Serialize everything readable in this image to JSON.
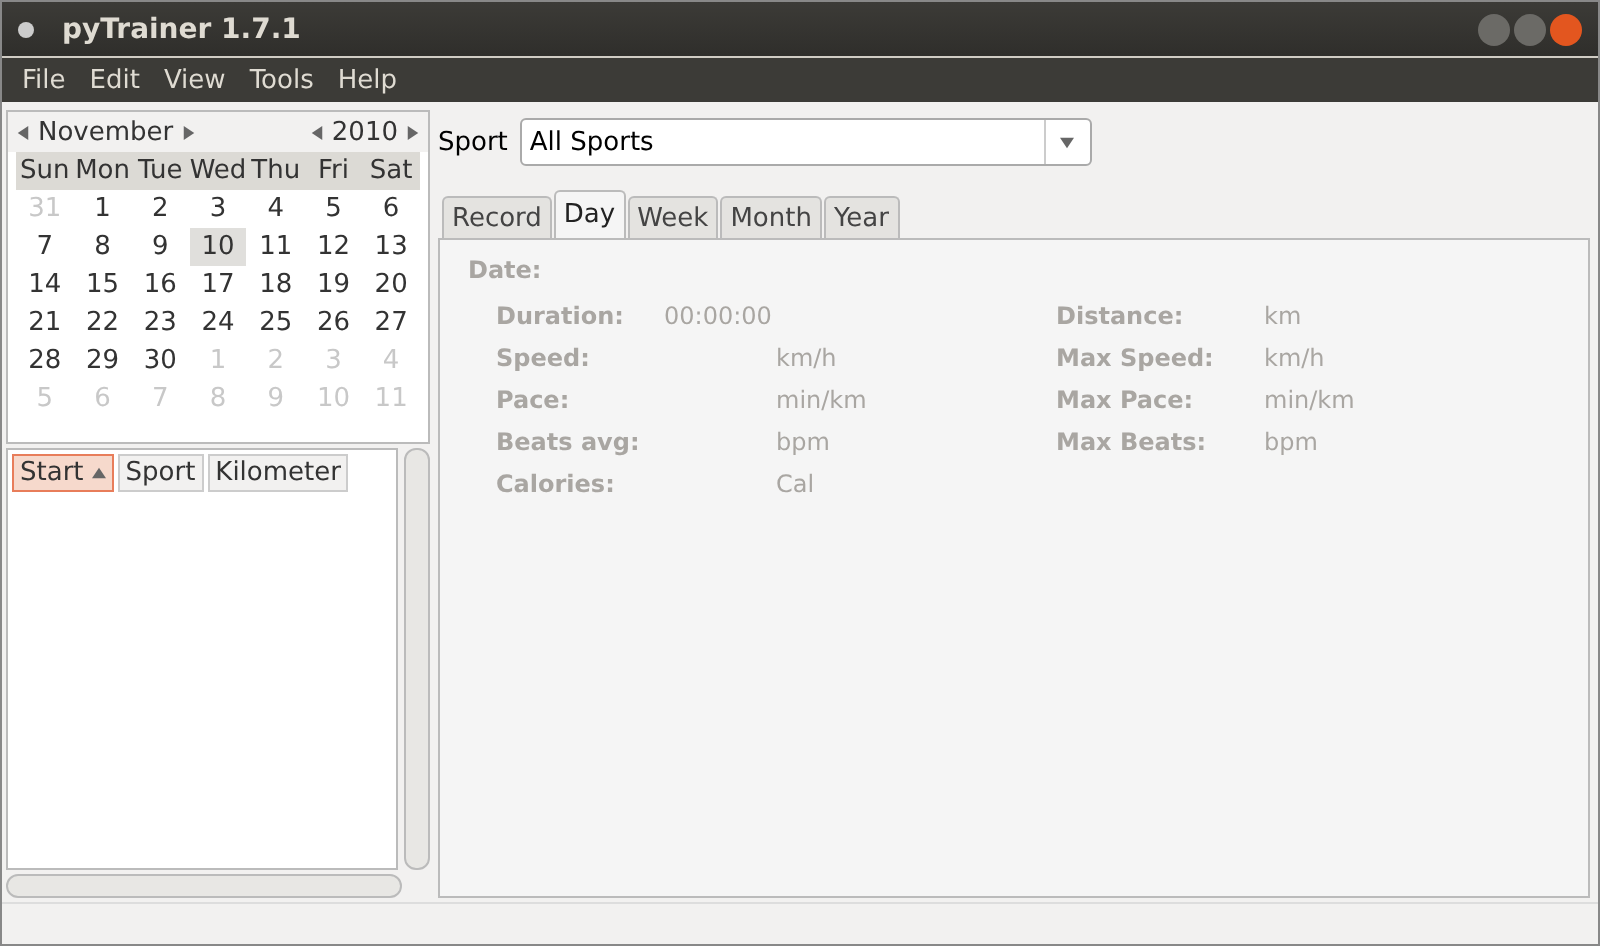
{
  "window": {
    "title": "pyTrainer 1.7.1"
  },
  "menu": [
    "File",
    "Edit",
    "View",
    "Tools",
    "Help"
  ],
  "calendar": {
    "month": "November",
    "year": "2010",
    "weekdays": [
      "Sun",
      "Mon",
      "Tue",
      "Wed",
      "Thu",
      "Fri",
      "Sat"
    ],
    "weeks": [
      [
        {
          "day": "31",
          "other_month": true,
          "selected": false
        },
        {
          "day": "1",
          "other_month": false,
          "selected": false
        },
        {
          "day": "2",
          "other_month": false,
          "selected": false
        },
        {
          "day": "3",
          "other_month": false,
          "selected": false
        },
        {
          "day": "4",
          "other_month": false,
          "selected": false
        },
        {
          "day": "5",
          "other_month": false,
          "selected": false
        },
        {
          "day": "6",
          "other_month": false,
          "selected": false
        }
      ],
      [
        {
          "day": "7",
          "other_month": false,
          "selected": false
        },
        {
          "day": "8",
          "other_month": false,
          "selected": false
        },
        {
          "day": "9",
          "other_month": false,
          "selected": false
        },
        {
          "day": "10",
          "other_month": false,
          "selected": true
        },
        {
          "day": "11",
          "other_month": false,
          "selected": false
        },
        {
          "day": "12",
          "other_month": false,
          "selected": false
        },
        {
          "day": "13",
          "other_month": false,
          "selected": false
        }
      ],
      [
        {
          "day": "14",
          "other_month": false,
          "selected": false
        },
        {
          "day": "15",
          "other_month": false,
          "selected": false
        },
        {
          "day": "16",
          "other_month": false,
          "selected": false
        },
        {
          "day": "17",
          "other_month": false,
          "selected": false
        },
        {
          "day": "18",
          "other_month": false,
          "selected": false
        },
        {
          "day": "19",
          "other_month": false,
          "selected": false
        },
        {
          "day": "20",
          "other_month": false,
          "selected": false
        }
      ],
      [
        {
          "day": "21",
          "other_month": false,
          "selected": false
        },
        {
          "day": "22",
          "other_month": false,
          "selected": false
        },
        {
          "day": "23",
          "other_month": false,
          "selected": false
        },
        {
          "day": "24",
          "other_month": false,
          "selected": false
        },
        {
          "day": "25",
          "other_month": false,
          "selected": false
        },
        {
          "day": "26",
          "other_month": false,
          "selected": false
        },
        {
          "day": "27",
          "other_month": false,
          "selected": false
        }
      ],
      [
        {
          "day": "28",
          "other_month": false,
          "selected": false
        },
        {
          "day": "29",
          "other_month": false,
          "selected": false
        },
        {
          "day": "30",
          "other_month": false,
          "selected": false
        },
        {
          "day": "1",
          "other_month": true,
          "selected": false
        },
        {
          "day": "2",
          "other_month": true,
          "selected": false
        },
        {
          "day": "3",
          "other_month": true,
          "selected": false
        },
        {
          "day": "4",
          "other_month": true,
          "selected": false
        }
      ],
      [
        {
          "day": "5",
          "other_month": true,
          "selected": false
        },
        {
          "day": "6",
          "other_month": true,
          "selected": false
        },
        {
          "day": "7",
          "other_month": true,
          "selected": false
        },
        {
          "day": "8",
          "other_month": true,
          "selected": false
        },
        {
          "day": "9",
          "other_month": true,
          "selected": false
        },
        {
          "day": "10",
          "other_month": true,
          "selected": false
        },
        {
          "day": "11",
          "other_month": true,
          "selected": false
        }
      ]
    ]
  },
  "table": {
    "columns": [
      {
        "label": "Start",
        "selected": true,
        "sorted": true
      },
      {
        "label": "Sport",
        "selected": false,
        "sorted": false
      },
      {
        "label": "Kilometer",
        "selected": false,
        "sorted": false
      }
    ]
  },
  "sport": {
    "label": "Sport",
    "value": "All Sports"
  },
  "tabs": [
    {
      "label": "Record",
      "selected": false
    },
    {
      "label": "Day",
      "selected": true
    },
    {
      "label": "Week",
      "selected": false
    },
    {
      "label": "Month",
      "selected": false
    },
    {
      "label": "Year",
      "selected": false
    }
  ],
  "day": {
    "date_label": "Date:",
    "left": [
      {
        "label": "Duration:",
        "value": "00:00:00"
      },
      {
        "label": "Speed:",
        "unit": "km/h"
      },
      {
        "label": "Pace:",
        "unit": "min/km"
      },
      {
        "label": "Beats avg:",
        "unit": "bpm"
      },
      {
        "label": "Calories:",
        "unit": "Cal"
      }
    ],
    "right": [
      {
        "label": "Distance:",
        "unit": "km"
      },
      {
        "label": "Max Speed:",
        "unit": "km/h"
      },
      {
        "label": "Max Pace:",
        "unit": "min/km"
      },
      {
        "label": "Max Beats:",
        "unit": "bpm"
      }
    ]
  }
}
